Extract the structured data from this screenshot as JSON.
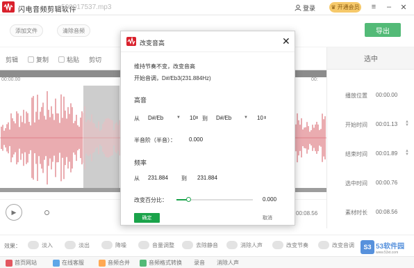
{
  "app": {
    "title": "闪电音频剪辑软件",
    "file_name": "- 500017537.mp3",
    "login_label": "登录",
    "vip_label": "开通会员"
  },
  "top": {
    "add_file": "添加文件",
    "clear_audio": "清除音频",
    "export": "导出"
  },
  "toolbar": {
    "cut": "剪辑",
    "copy": "复制",
    "paste": "粘贴",
    "trim": "剪切"
  },
  "waveform": {
    "ruler_start": "00:00.00",
    "ruler_end": "00:"
  },
  "player": {
    "total": "00:08.56"
  },
  "panel": {
    "title": "选中",
    "rows": [
      {
        "label": "播放位置",
        "value": "00:00.00",
        "spin": false
      },
      {
        "label": "开始时间",
        "value": "00:01.13",
        "spin": true
      },
      {
        "label": "结束时间",
        "value": "00:01.89",
        "spin": true
      },
      {
        "label": "选中时间",
        "value": "00:00.76",
        "spin": false
      },
      {
        "label": "素材时长",
        "value": "00:08.56",
        "spin": false
      }
    ]
  },
  "effects": {
    "label": "效果：",
    "items": [
      "淡入",
      "淡出",
      "降噪",
      "音量调整",
      "去除静音",
      "消除人声",
      "改变节奏",
      "改变音调"
    ]
  },
  "bottom": {
    "items": [
      "首页网站",
      "在线客服",
      "音频合并",
      "音频格式转换",
      "录音",
      "消除人声"
    ]
  },
  "watermark": {
    "logo": "S3",
    "text": "53软件园",
    "url": "www.53xt.com"
  },
  "dialog": {
    "title": "改变音高",
    "desc1": "维持节奏不变，改变音高",
    "desc2": "开始音调，D#/Eb3(231.884Hz)",
    "pitch_section": "高音",
    "from_label": "从",
    "to_label": "到",
    "from_note": "D#/Eb",
    "from_octave": "10",
    "to_note": "D#/Eb",
    "to_octave": "10",
    "semitone_label": "半音阶（半音）：",
    "semitone_value": "0.000",
    "freq_section": "频率",
    "freq_from": "231.884",
    "freq_to": "231.884",
    "percent_label": "改变百分比：",
    "percent_value": "0.000",
    "percent_slider": 0.15,
    "ok": "确定",
    "cancel": "取消"
  },
  "colors": {
    "accent": "#1aa34a",
    "brand": "#d9212c",
    "wave": "#c8202e",
    "vip": "#f6c96a"
  }
}
